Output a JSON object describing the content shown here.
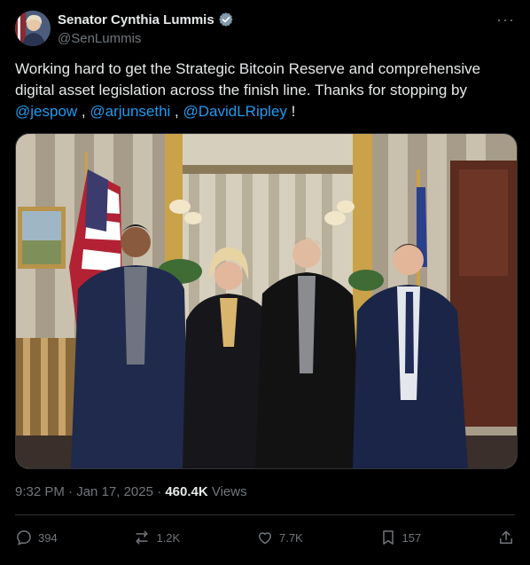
{
  "author": {
    "name": "Senator Cynthia Lummis",
    "handle": "@SenLummis",
    "verified_color": "#829aab"
  },
  "more_label": "···",
  "tweet": {
    "text_1": "Working hard to get the Strategic Bitcoin Reserve and comprehensive digital asset legislation across the finish line. Thanks for stopping by ",
    "mention_1": "@jespow",
    "sep_1": " , ",
    "mention_2": "@arjunsethi",
    "sep_2": " , ",
    "mention_3": "@DavidLRipley",
    "end": " !"
  },
  "meta": {
    "time": "9:32 PM",
    "dot_1": " · ",
    "date": "Jan 17, 2025",
    "dot_2": " · ",
    "views_count": "460.4K",
    "views_label": " Views"
  },
  "actions": {
    "replies": "394",
    "reposts": "1.2K",
    "likes": "7.7K",
    "bookmarks": "157"
  },
  "colors": {
    "background": "#000000",
    "text": "#e7e9ea",
    "muted": "#71767b",
    "link": "#1d9bf0",
    "border": "#2f3336"
  }
}
